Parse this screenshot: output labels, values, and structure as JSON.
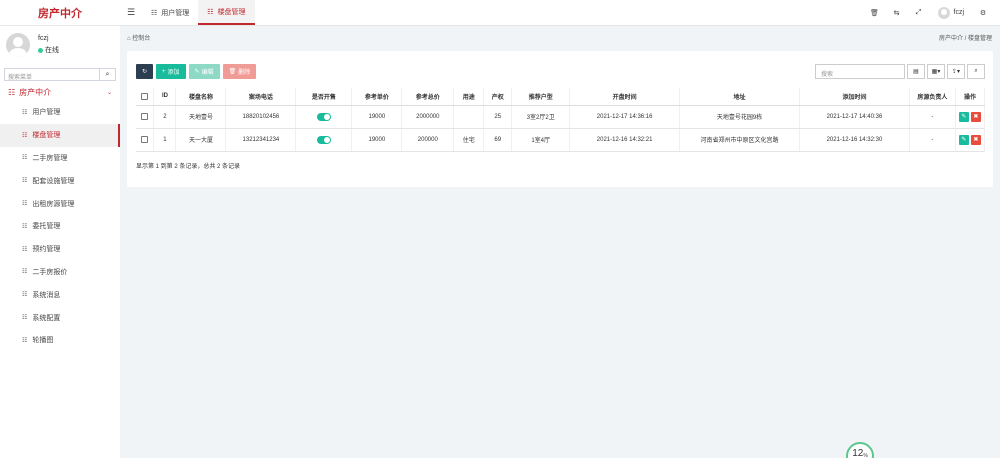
{
  "app": {
    "logo": "房产中介"
  },
  "header": {
    "tabs": [
      {
        "label": "用户管理",
        "icon": "list-icon"
      },
      {
        "label": "楼盘管理",
        "icon": "list-icon"
      }
    ],
    "user": "fczj"
  },
  "sidebar": {
    "username": "fczj",
    "status": "在线",
    "search_placeholder": "搜索菜单",
    "section": "房产中介",
    "items": [
      {
        "label": "用户管理"
      },
      {
        "label": "楼盘管理"
      },
      {
        "label": "二手房管理"
      },
      {
        "label": "配套设施管理"
      },
      {
        "label": "出租房源管理"
      },
      {
        "label": "委托管理"
      },
      {
        "label": "预约管理"
      },
      {
        "label": "二手房报价"
      },
      {
        "label": "系统消息"
      },
      {
        "label": "系统配置"
      },
      {
        "label": "轮播图"
      }
    ]
  },
  "breadcrumb": {
    "home": "控制台",
    "path1": "房产中介",
    "sep": "/",
    "path2": "楼盘管理"
  },
  "toolbar": {
    "add": "添加",
    "edit": "编辑",
    "delete": "删除",
    "search_placeholder": "搜索"
  },
  "table": {
    "headers": [
      "ID",
      "楼盘名称",
      "案场电话",
      "是否开售",
      "参考单价",
      "参考总价",
      "用途",
      "产权",
      "推荐户型",
      "开盘时间",
      "地址",
      "添加时间",
      "房源负责人",
      "操作"
    ],
    "rows": [
      {
        "id": "2",
        "name": "天地壹号",
        "phone": "18820102456",
        "on_sale": true,
        "unit_price": "19000",
        "total_price": "2000000",
        "usage": "",
        "property": "25",
        "layout": "3室2厅2卫",
        "open_time": "2021-12-17 14:36:16",
        "address": "天地壹号花园9栋",
        "add_time": "2021-12-17 14:40:36",
        "agent": "-"
      },
      {
        "id": "1",
        "name": "天一大厦",
        "phone": "13212341234",
        "on_sale": true,
        "unit_price": "19000",
        "total_price": "200000",
        "usage": "住宅",
        "property": "69",
        "layout": "1室4厅",
        "open_time": "2021-12-16 14:32:21",
        "address": "河南省郑州市中原区文化宫路",
        "add_time": "2021-12-16 14:32:30",
        "agent": "-"
      }
    ]
  },
  "summary": "显示第 1 到第 2 条记录，总共 2 条记录",
  "progress": {
    "value": "12",
    "unit": "%"
  },
  "colors": {
    "brand": "#c0282e",
    "success": "#18bc9c",
    "danger": "#e74c3c",
    "dark": "#2c3e50"
  }
}
